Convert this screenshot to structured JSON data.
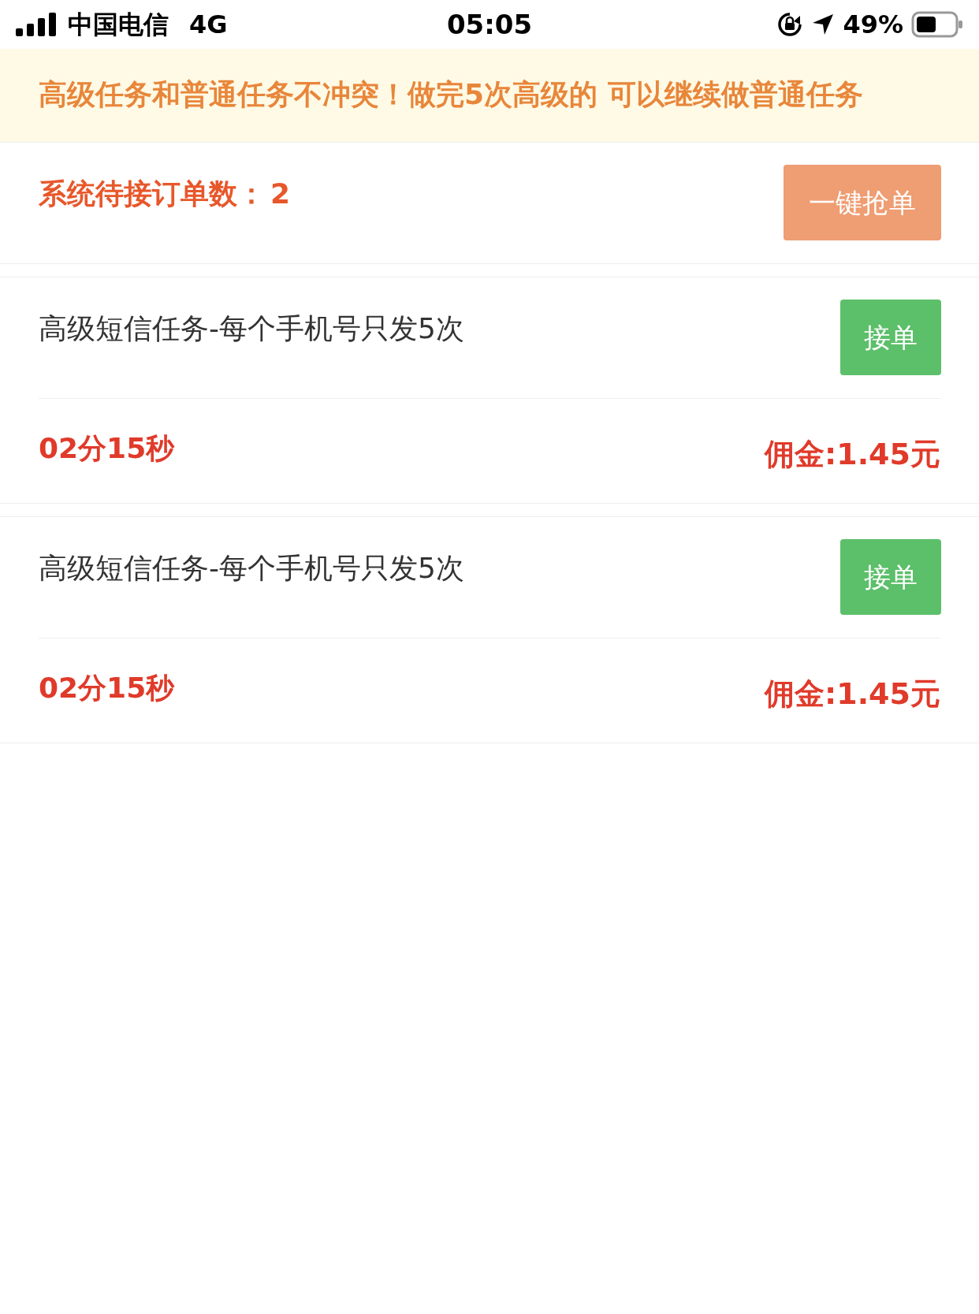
{
  "status_bar": {
    "carrier": "中国电信",
    "network": "4G",
    "time": "05:05",
    "battery_percent": "49%"
  },
  "notice": {
    "text": "高级任务和普通任务不冲突！做完5次高级的 可以继续做普通任务"
  },
  "pending": {
    "label": "系统待接订单数：",
    "count": "2",
    "button": "一键抢单"
  },
  "tasks": [
    {
      "title": "高级短信任务-每个手机号只发5次",
      "button": "接单",
      "countdown": "02分15秒",
      "commission": "佣金:1.45元"
    },
    {
      "title": "高级短信任务-每个手机号只发5次",
      "button": "接单",
      "countdown": "02分15秒",
      "commission": "佣金:1.45元"
    }
  ]
}
